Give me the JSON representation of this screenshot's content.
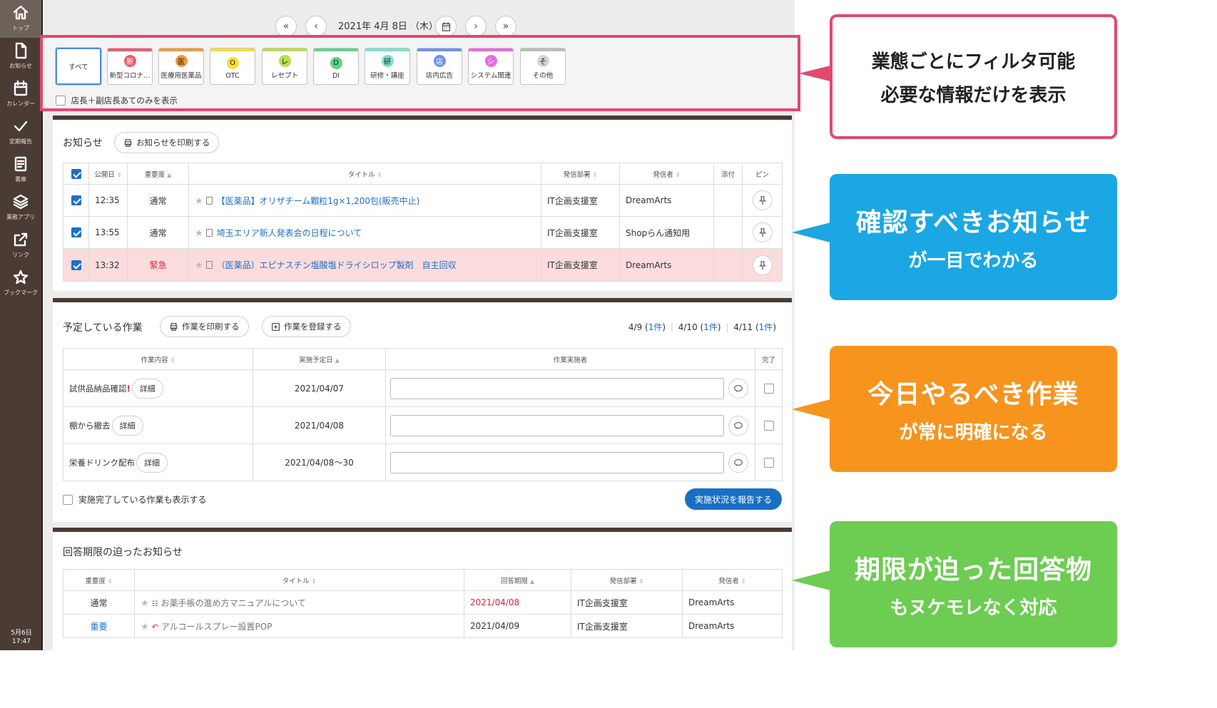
{
  "sidebar": {
    "items": [
      {
        "label": "トップ",
        "icon": "home-icon",
        "active": true
      },
      {
        "label": "お知らせ",
        "icon": "document-icon"
      },
      {
        "label": "カレンダー",
        "icon": "calendar-icon"
      },
      {
        "label": "定期報告",
        "icon": "checkmark-icon"
      },
      {
        "label": "書庫",
        "icon": "book-icon"
      },
      {
        "label": "業務アプリ",
        "icon": "layers-icon"
      },
      {
        "label": "リンク",
        "icon": "external-link-icon"
      },
      {
        "label": "ブックマーク",
        "icon": "star-icon"
      }
    ],
    "date": "5月6日",
    "time": "17:47"
  },
  "date_nav": {
    "date": "2021年 4月 8日 （木）",
    "first": "«",
    "prev": "‹",
    "next": "›",
    "last": "»"
  },
  "filter": {
    "chips": [
      {
        "label": "すべて",
        "badge": "",
        "selected": true
      },
      {
        "label": "新型コロナ…",
        "badge": "新",
        "color": "#f05a6e"
      },
      {
        "label": "医療用医薬品",
        "badge": "医",
        "color": "#f39a3c"
      },
      {
        "label": "OTC",
        "badge": "O",
        "color": "#f6df3a"
      },
      {
        "label": "レセプト",
        "badge": "レ",
        "color": "#b6e04a"
      },
      {
        "label": "DI",
        "badge": "D",
        "color": "#5ed38a"
      },
      {
        "label": "研修・講座",
        "badge": "研",
        "color": "#7be2cf"
      },
      {
        "label": "店内広告",
        "badge": "店",
        "color": "#6f8ff0"
      },
      {
        "label": "システム関連",
        "badge": "シ",
        "color": "#e86ae0"
      },
      {
        "label": "その他",
        "badge": "そ",
        "color": "#bdbdbd"
      }
    ],
    "only_manager_label": "店長＋副店長あてのみを表示"
  },
  "notices": {
    "title": "お知らせ",
    "print_button": "お知らせを印刷する",
    "columns": [
      "公開日",
      "重要度",
      "タイトル",
      "発信部署",
      "発信者",
      "添付",
      "ピン"
    ],
    "rows": [
      {
        "time": "12:35",
        "priority": "通常",
        "title": "【医薬品】オリザチーム顆粒1g×1,200包(販売中止)",
        "dept": "IT企画支援室",
        "sender": "DreamArts",
        "urgent": false
      },
      {
        "time": "13:55",
        "priority": "通常",
        "title": "埼玉エリア新人発表会の日程について",
        "dept": "IT企画支援室",
        "sender": "Shopらん通知用",
        "urgent": false
      },
      {
        "time": "13:32",
        "priority": "緊急",
        "title": "（医薬品）エピナスチン塩酸塩ドライシロップ製剤　自主回収",
        "dept": "IT企画支援室",
        "sender": "DreamArts",
        "urgent": true
      }
    ]
  },
  "tasks": {
    "title": "予定している作業",
    "print_button": "作業を印刷する",
    "register_button": "作業を登録する",
    "days": [
      {
        "date": "4/9",
        "count": "1件"
      },
      {
        "date": "4/10",
        "count": "1件"
      },
      {
        "date": "4/11",
        "count": "1件"
      }
    ],
    "columns": [
      "作業内容",
      "実施予定日",
      "作業実施者",
      "完了"
    ],
    "detail_label": "詳細",
    "rows": [
      {
        "name": "試供品納品確認",
        "alert": "!",
        "date": "2021/04/07"
      },
      {
        "name": "棚から撤去",
        "alert": "",
        "date": "2021/04/08"
      },
      {
        "name": "栄養ドリンク配布",
        "alert": "",
        "date": "2021/04/08～30"
      }
    ],
    "show_completed_label": "実施完了している作業も表示する",
    "report_button": "実施状況を報告する"
  },
  "deadline": {
    "title": "回答期限の迫ったお知らせ",
    "columns": [
      "重要度",
      "タイトル",
      "回答期限",
      "発信部署",
      "発信者"
    ],
    "rows": [
      {
        "priority": "通常",
        "title": "お薬手帳の進め方マニュアルについて",
        "due": "2021/04/08",
        "dept": "IT企画支援室",
        "sender": "DreamArts",
        "due_red": true,
        "priority_blue": false
      },
      {
        "priority": "重要",
        "title": "アルコールスプレー設置POP",
        "due": "2021/04/09",
        "dept": "IT企画支援室",
        "sender": "DreamArts",
        "due_red": false,
        "priority_blue": true
      }
    ]
  },
  "callouts": [
    {
      "line1": "業態ごとにフィルタ可能",
      "line2": "必要な情報だけを表示",
      "color": "#e2486f"
    },
    {
      "line1": "確認すべきお知らせ",
      "line2": "が一目でわかる",
      "color": "#1aa7e4"
    },
    {
      "line1": "今日やるべき作業",
      "line2": "が常に明確になる",
      "color": "#f6941e"
    },
    {
      "line1": "期限が迫った回答物",
      "line2": "もヌケモレなく対応",
      "color": "#6dcc52"
    }
  ]
}
